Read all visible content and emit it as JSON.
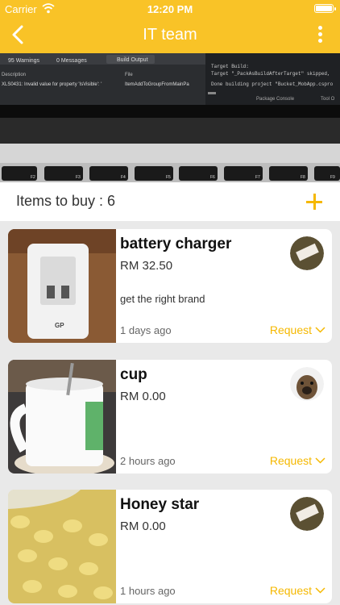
{
  "status_bar": {
    "carrier": "Carrier",
    "time": "12:20 PM"
  },
  "nav": {
    "title": "IT team"
  },
  "banner": {
    "warnings": "95 Warnings",
    "messages": "0 Messages",
    "build_output": "Build Output",
    "col_description": "Description",
    "col_file": "File",
    "row_text": "XLS0431: Invalid value for property 'IsVisible': '",
    "row_file": "ItemAddToGroupFromMainPa",
    "log_lines": [
      "Target Build:",
      "Target \"_PackAsBuildAfterTarget\" skipped,",
      "Done building project \"Bucket_MobApp.cspro"
    ],
    "package_console": "Package Console",
    "tool_output": "Tool O",
    "keys": [
      "F2",
      "F3",
      "F4",
      "F5",
      "F6",
      "F7",
      "F8",
      "F9"
    ]
  },
  "list_header": {
    "label": "Items to buy : 6"
  },
  "items": [
    {
      "name": "battery charger",
      "price": "RM 32.50",
      "note": "get the right brand",
      "time": "1 days ago",
      "action": "Request",
      "thumb_text": "GP"
    },
    {
      "name": "cup",
      "price": "RM 0.00",
      "note": "",
      "time": "2 hours ago",
      "action": "Request"
    },
    {
      "name": "Honey star",
      "price": "RM 0.00",
      "note": "",
      "time": "1 hours ago",
      "action": "Request"
    }
  ],
  "colors": {
    "accent": "#f9c327",
    "action": "#f5b800",
    "background": "#e9e9e9"
  },
  "icons": {
    "back": "chevron-left-icon",
    "more": "more-vertical-icon",
    "add": "plus-icon",
    "expand": "chevron-down-icon"
  }
}
